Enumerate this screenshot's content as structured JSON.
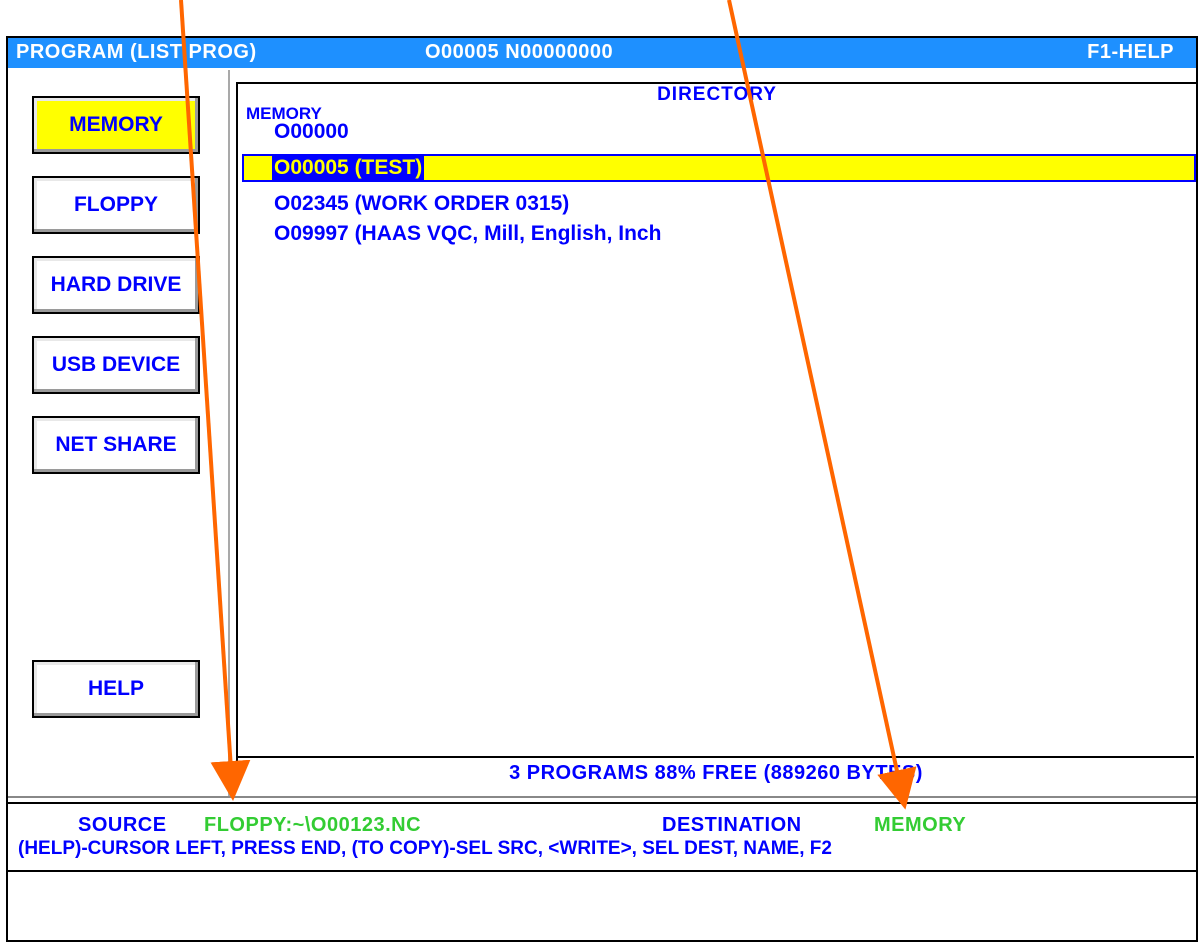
{
  "titlebar": {
    "mode": "PROGRAM (LIST PROG)",
    "program_number": "O00005 N00000000",
    "help": "F1-HELP"
  },
  "sidebar": {
    "items": [
      {
        "label": "MEMORY",
        "active": true
      },
      {
        "label": "FLOPPY",
        "active": false
      },
      {
        "label": "HARD DRIVE",
        "active": false
      },
      {
        "label": "USB DEVICE",
        "active": false
      },
      {
        "label": "NET SHARE",
        "active": false
      },
      {
        "label": "HELP",
        "active": false
      }
    ]
  },
  "directory": {
    "title": "DIRECTORY",
    "location": "MEMORY",
    "files": [
      {
        "name": "O00000"
      },
      {
        "name": "O00005 (TEST)",
        "selected": true
      },
      {
        "name": "O02345 (WORK ORDER 0315)"
      },
      {
        "name": "O09997 (HAAS VQC, Mill, English, Inch"
      }
    ],
    "summary": "3 PROGRAMS 88% FREE (889260 BYTES)"
  },
  "status": {
    "source_label": "SOURCE",
    "source_value": "FLOPPY:~\\O00123.NC",
    "destination_label": "DESTINATION",
    "destination_value": "MEMORY",
    "hint": "(HELP)-CURSOR LEFT, PRESS END,  (TO COPY)-SEL SRC, <WRITE>, SEL DEST, NAME, F2"
  },
  "colors": {
    "titlebar": "#1e90ff",
    "text": "#0000ff",
    "highlight": "#ffff00",
    "status_value": "#33cc33",
    "annotation_arrow": "#ff6600"
  }
}
